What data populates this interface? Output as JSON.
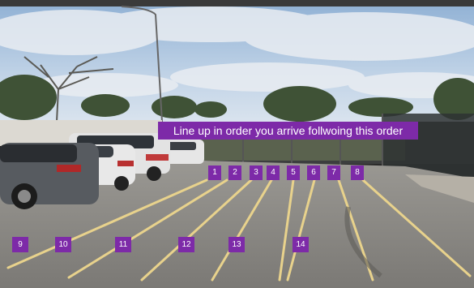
{
  "banner": {
    "text": "Line up in order you arrive follwoing this order",
    "color": "#7d2aa8"
  },
  "spots": [
    {
      "id": "1",
      "label": "1"
    },
    {
      "id": "2",
      "label": "2"
    },
    {
      "id": "3",
      "label": "3"
    },
    {
      "id": "4",
      "label": "4"
    },
    {
      "id": "5",
      "label": "5"
    },
    {
      "id": "6",
      "label": "6"
    },
    {
      "id": "7",
      "label": "7"
    },
    {
      "id": "8",
      "label": "8"
    },
    {
      "id": "9",
      "label": "9"
    },
    {
      "id": "10",
      "label": "10"
    },
    {
      "id": "11",
      "label": "11"
    },
    {
      "id": "12",
      "label": "12"
    },
    {
      "id": "13",
      "label": "13"
    },
    {
      "id": "14",
      "label": "14"
    }
  ],
  "palette": {
    "label_bg": "#7d2aa8",
    "label_text": "#ffffff",
    "asphalt": "#8a8884",
    "stripe": "#e8d28c",
    "sky": "#a9c2dc"
  }
}
